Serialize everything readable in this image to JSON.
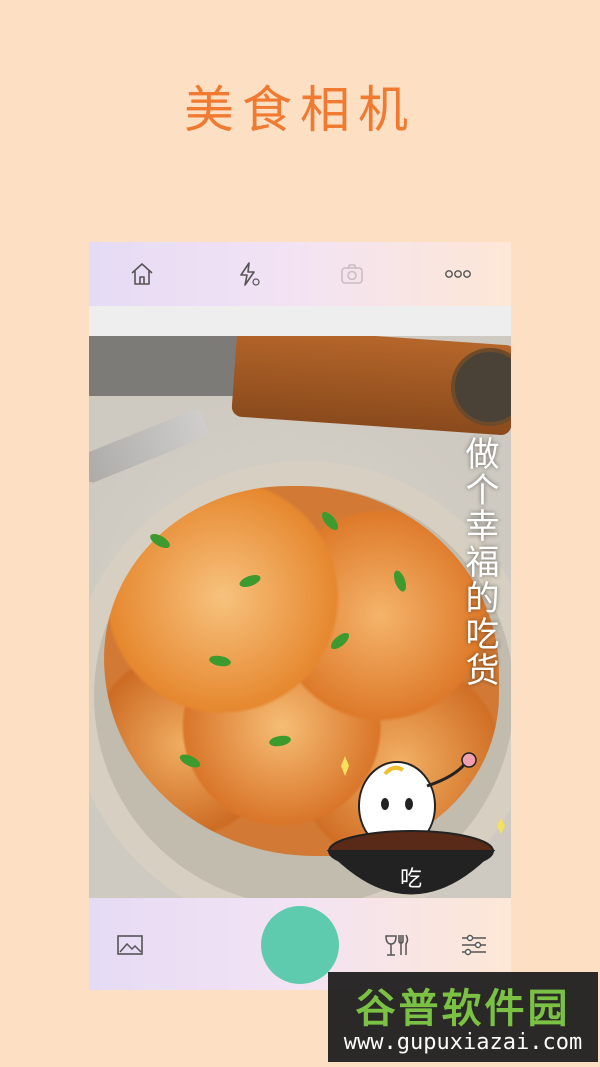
{
  "promo": {
    "title": "美食相机"
  },
  "top_bar": {
    "icons": [
      "home-icon",
      "flash-icon",
      "switch-camera-icon",
      "more-icon"
    ]
  },
  "viewfinder": {
    "sticker_text": "做个幸福的吃货",
    "mascot_label": "吃"
  },
  "bottom_bar": {
    "icons": [
      "gallery-icon",
      "food-mode-icon",
      "settings-sliders-icon"
    ],
    "shutter_color": "#5fcbae"
  },
  "watermark": {
    "title": "谷普软件园",
    "url": "www.gupuxiazai.com"
  },
  "colors": {
    "background": "#fde0c3",
    "title": "#f07a32",
    "accent": "#5fcbae"
  }
}
